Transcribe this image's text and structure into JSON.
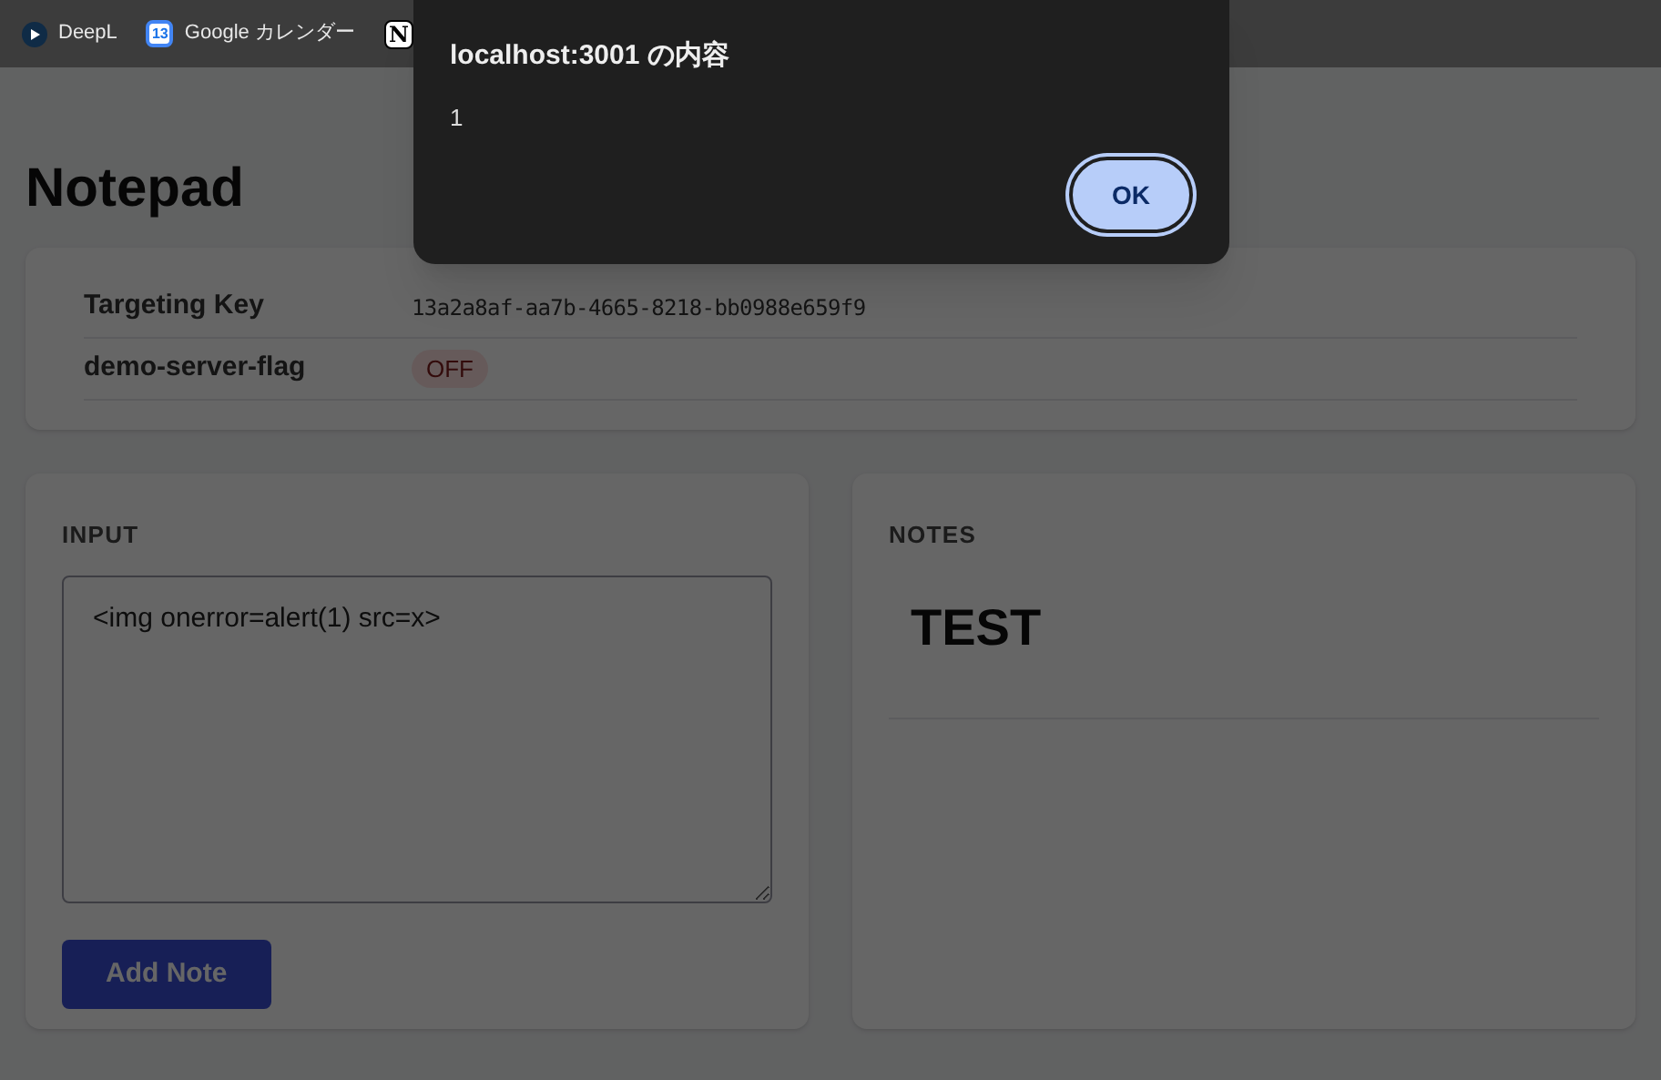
{
  "bookmarks": [
    {
      "kind": "deepl",
      "label": "DeepL"
    },
    {
      "kind": "calendar",
      "label": "Google カレンダー",
      "icon_text": "13"
    },
    {
      "kind": "notion",
      "icon_text": "N"
    }
  ],
  "page": {
    "title": "Notepad"
  },
  "flags": [
    {
      "label": "Targeting Key",
      "kind": "text",
      "value": "13a2a8af-aa7b-4665-8218-bb0988e659f9"
    },
    {
      "label": "demo-server-flag",
      "kind": "toggle",
      "value": "OFF",
      "on": false
    }
  ],
  "input": {
    "heading": "INPUT",
    "value": "<img onerror=alert(1) src=x>",
    "button": "Add Note"
  },
  "notes": {
    "heading": "NOTES",
    "items": [
      "TEST"
    ]
  },
  "dialog": {
    "title": "localhost:3001 の内容",
    "message": "1",
    "button": "OK"
  }
}
